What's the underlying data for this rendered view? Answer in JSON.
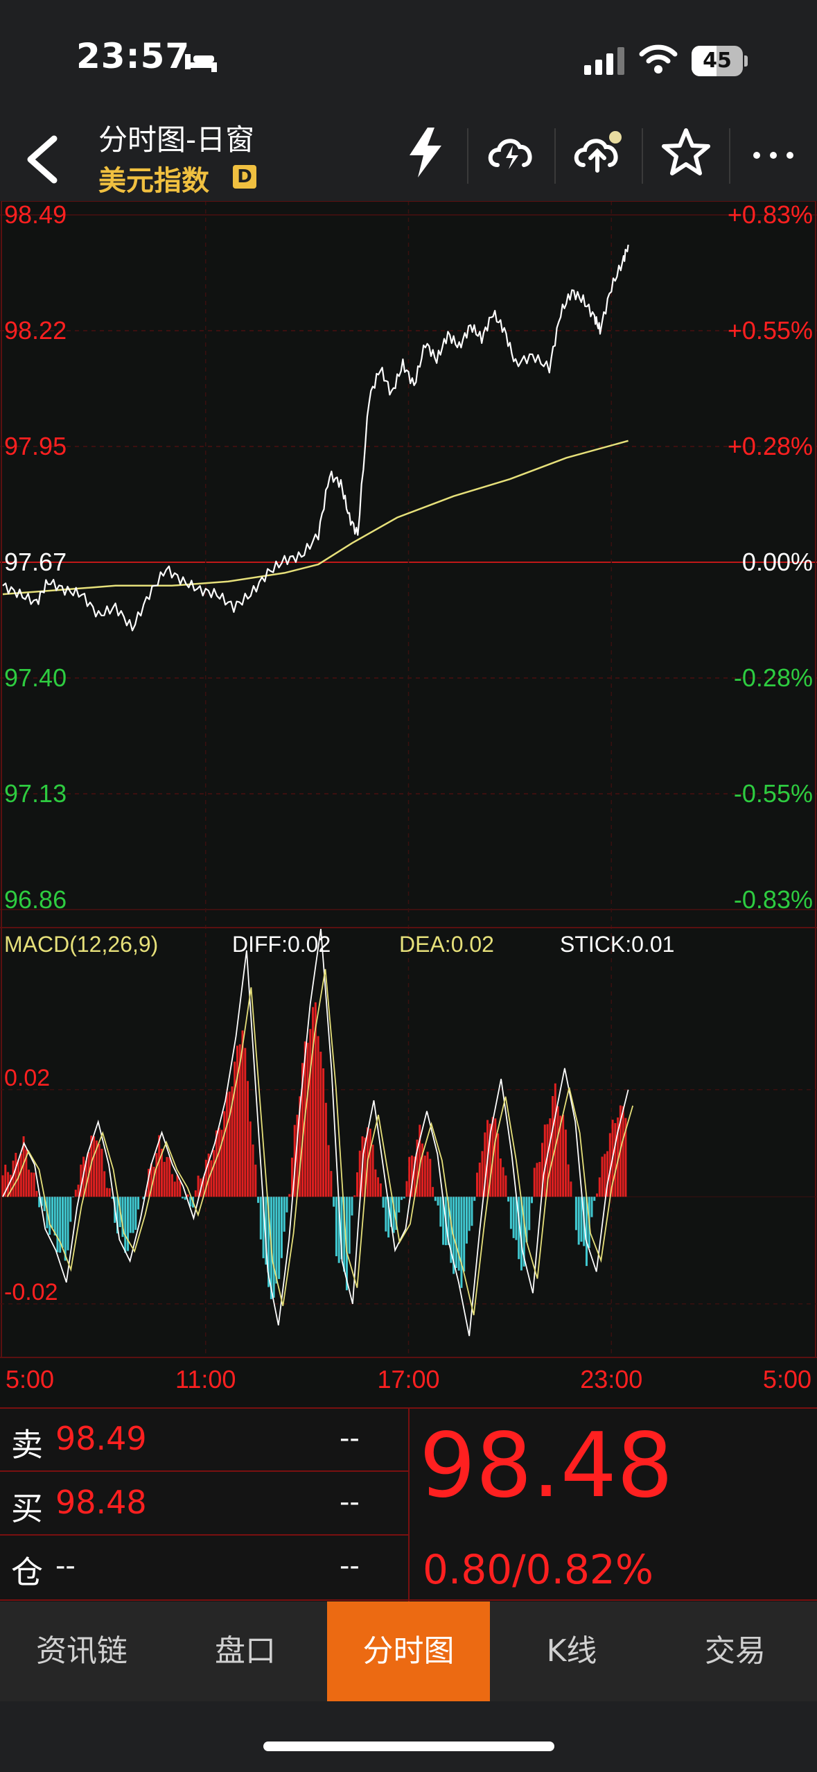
{
  "status": {
    "time": "23:57",
    "battery": "45"
  },
  "header": {
    "title": "分时图-日窗",
    "subtitle": "美元指数",
    "badge": "D"
  },
  "price_axis": {
    "left": [
      "98.49",
      "98.22",
      "97.95",
      "97.67",
      "97.40",
      "97.13",
      "96.86"
    ],
    "right": [
      "+0.83%",
      "+0.55%",
      "+0.28%",
      "0.00%",
      "-0.28%",
      "-0.55%",
      "-0.83%"
    ]
  },
  "macd": {
    "title": "MACD(12,26,9)",
    "diff": "DIFF:0.02",
    "dea": "DEA:0.02",
    "stick": "STICK:0.01",
    "axis": [
      "0.02",
      "-0.02"
    ]
  },
  "time_axis": [
    "5:00",
    "11:00",
    "17:00",
    "23:00",
    "5:00"
  ],
  "quote": {
    "sell_label": "卖",
    "sell_price": "98.49",
    "sell_qty": "--",
    "buy_label": "买",
    "buy_price": "98.48",
    "buy_qty": "--",
    "pos_label": "仓",
    "pos_value": "--",
    "pos_qty": "--",
    "last_price": "98.48",
    "change": "0.80/0.82%"
  },
  "tabs": [
    "资讯链",
    "盘口",
    "分时图",
    "K线",
    "交易"
  ],
  "active_tab": 2,
  "colors": {
    "up": "#ff2020",
    "down": "#2ecc40",
    "price_line": "#ffffff",
    "avg_line": "#e6e07a",
    "macd_pos": "#e02020",
    "macd_neg": "#40c8d0",
    "accent": "#ec6a12"
  },
  "chart_data": {
    "type": "line",
    "ylim": [
      96.86,
      98.49
    ],
    "xlim": [
      0,
      1440
    ],
    "base": 97.67,
    "price": [
      [
        0,
        97.62
      ],
      [
        30,
        97.6
      ],
      [
        60,
        97.58
      ],
      [
        80,
        97.63
      ],
      [
        110,
        97.61
      ],
      [
        140,
        97.6
      ],
      [
        170,
        97.55
      ],
      [
        200,
        97.57
      ],
      [
        230,
        97.52
      ],
      [
        260,
        97.6
      ],
      [
        290,
        97.66
      ],
      [
        320,
        97.63
      ],
      [
        350,
        97.61
      ],
      [
        380,
        97.6
      ],
      [
        410,
        97.57
      ],
      [
        440,
        97.6
      ],
      [
        470,
        97.65
      ],
      [
        500,
        97.68
      ],
      [
        530,
        97.69
      ],
      [
        560,
        97.74
      ],
      [
        580,
        97.88
      ],
      [
        600,
        97.86
      ],
      [
        615,
        97.78
      ],
      [
        630,
        97.74
      ],
      [
        650,
        98.06
      ],
      [
        670,
        98.13
      ],
      [
        690,
        98.07
      ],
      [
        710,
        98.14
      ],
      [
        730,
        98.09
      ],
      [
        750,
        98.19
      ],
      [
        770,
        98.15
      ],
      [
        790,
        98.21
      ],
      [
        810,
        98.18
      ],
      [
        830,
        98.23
      ],
      [
        850,
        98.2
      ],
      [
        870,
        98.26
      ],
      [
        890,
        98.22
      ],
      [
        910,
        98.14
      ],
      [
        940,
        98.16
      ],
      [
        970,
        98.13
      ],
      [
        990,
        98.26
      ],
      [
        1010,
        98.31
      ],
      [
        1030,
        98.29
      ],
      [
        1050,
        98.25
      ],
      [
        1060,
        98.22
      ],
      [
        1080,
        98.32
      ],
      [
        1100,
        98.38
      ],
      [
        1110,
        98.42
      ]
    ],
    "avg": [
      [
        0,
        97.6
      ],
      [
        100,
        97.61
      ],
      [
        200,
        97.62
      ],
      [
        300,
        97.62
      ],
      [
        400,
        97.63
      ],
      [
        500,
        97.65
      ],
      [
        560,
        97.67
      ],
      [
        620,
        97.72
      ],
      [
        700,
        97.78
      ],
      [
        800,
        97.83
      ],
      [
        900,
        97.87
      ],
      [
        1000,
        97.92
      ],
      [
        1110,
        97.96
      ]
    ],
    "macd_hist": [
      0.004,
      0.006,
      0.01,
      0.003,
      -0.004,
      -0.008,
      -0.012,
      0.002,
      0.008,
      0.012,
      0.003,
      -0.006,
      -0.01,
      -0.003,
      0.004,
      0.01,
      0.006,
      0.002,
      -0.002,
      0.004,
      0.008,
      0.014,
      0.022,
      0.032,
      0.01,
      -0.012,
      -0.02,
      -0.008,
      0.012,
      0.028,
      0.036,
      0.018,
      -0.01,
      -0.016,
      0.006,
      0.014,
      0.004,
      -0.008,
      -0.004,
      0.006,
      0.012,
      0.006,
      -0.006,
      -0.012,
      -0.016,
      -0.004,
      0.01,
      0.016,
      0.006,
      -0.008,
      -0.014,
      0.004,
      0.012,
      0.02,
      0.012,
      -0.006,
      -0.012,
      0.002,
      0.01,
      0.016
    ],
    "macd_diff": [
      0.0,
      0.004,
      0.01,
      0.006,
      -0.006,
      -0.01,
      -0.016,
      -0.002,
      0.008,
      0.014,
      0.006,
      -0.008,
      -0.012,
      -0.004,
      0.006,
      0.012,
      0.006,
      0.002,
      -0.004,
      0.004,
      0.01,
      0.018,
      0.03,
      0.046,
      0.016,
      -0.014,
      -0.024,
      -0.008,
      0.016,
      0.036,
      0.05,
      0.024,
      -0.012,
      -0.02,
      0.008,
      0.018,
      0.004,
      -0.01,
      -0.006,
      0.008,
      0.016,
      0.008,
      -0.008,
      -0.016,
      -0.026,
      -0.006,
      0.012,
      0.022,
      0.008,
      -0.01,
      -0.018,
      0.004,
      0.014,
      0.024,
      0.014,
      -0.008,
      -0.014,
      0.002,
      0.012,
      0.02
    ],
    "macd_ylim": [
      -0.03,
      0.05
    ]
  }
}
